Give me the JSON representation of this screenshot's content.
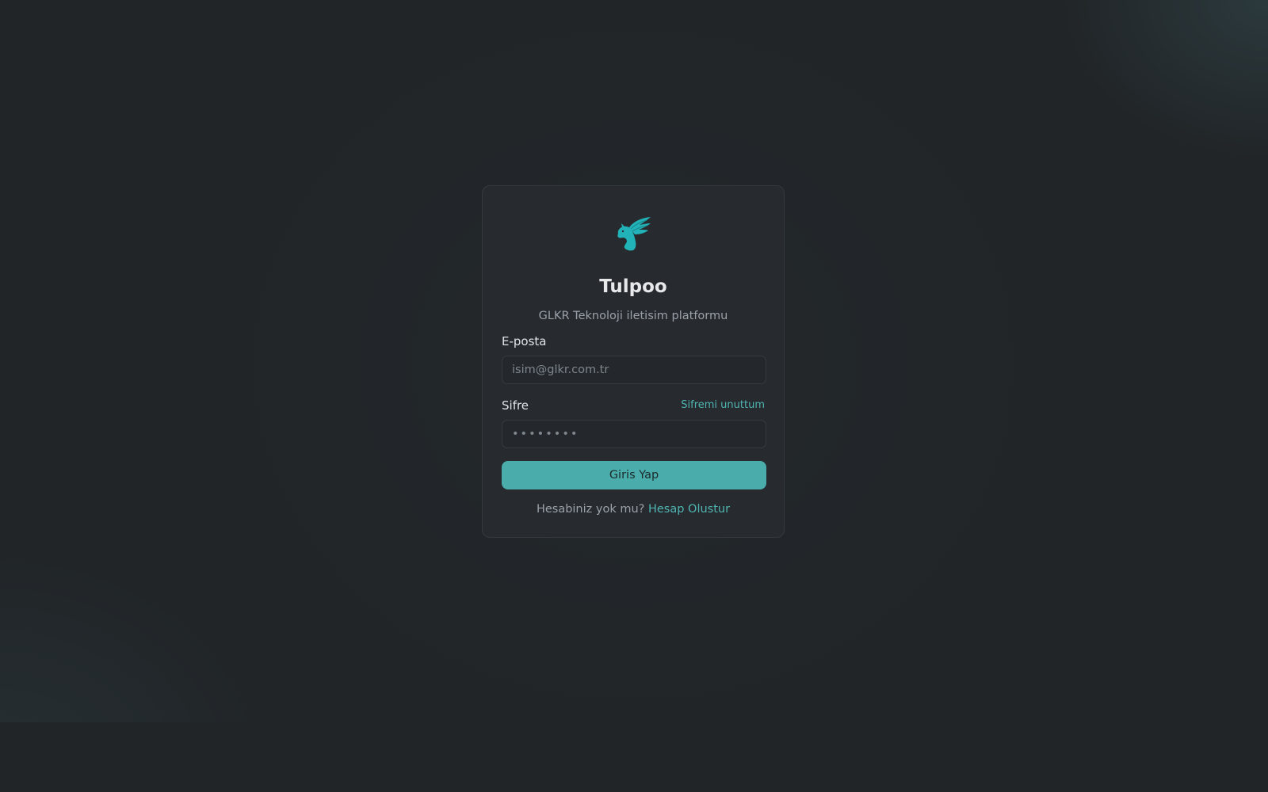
{
  "app": {
    "title": "Tulpoo",
    "subtitle": "GLKR Teknoloji iletisim platformu",
    "logo_icon": "pegasus-icon",
    "accent_color": "#4aadab",
    "background_color": "#212528"
  },
  "form": {
    "email": {
      "label": "E-posta",
      "placeholder": "isim@glkr.com.tr",
      "value": ""
    },
    "password": {
      "label": "Sifre",
      "placeholder": "••••••••",
      "value": "",
      "forgot_link": "Sifremi unuttum"
    },
    "submit_label": "Giris Yap"
  },
  "signup": {
    "question": "Hesabiniz yok mu?",
    "link": "Hesap Olustur"
  }
}
